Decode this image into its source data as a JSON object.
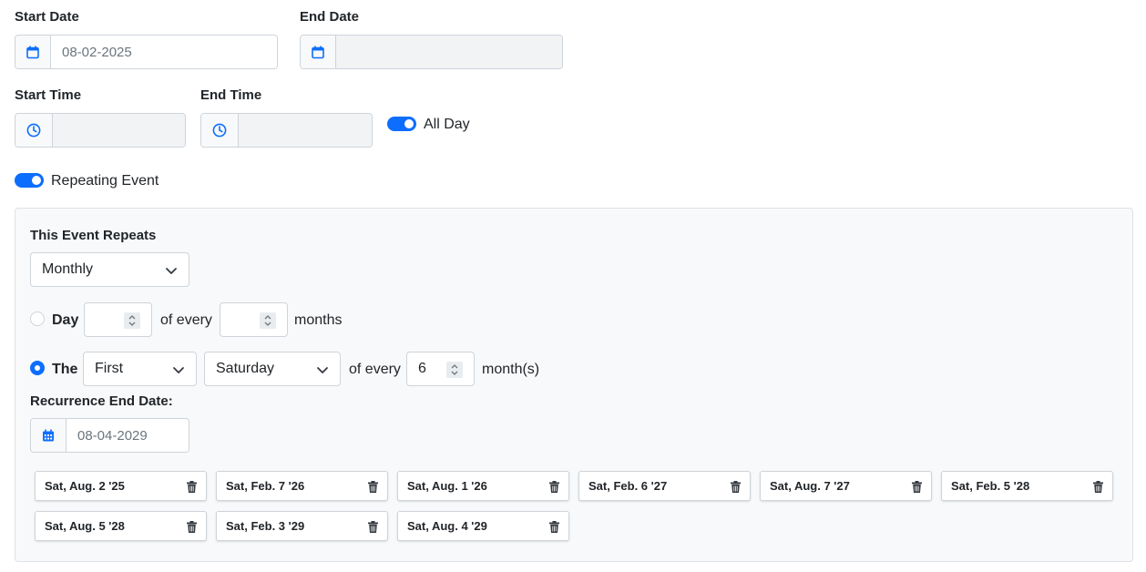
{
  "start_date": {
    "label": "Start Date",
    "value": "08-02-2025",
    "icon": "calendar-icon"
  },
  "end_date": {
    "label": "End Date",
    "value": "",
    "icon": "calendar-icon"
  },
  "start_time": {
    "label": "Start Time",
    "value": "",
    "icon": "clock-icon"
  },
  "end_time": {
    "label": "End Time",
    "value": "",
    "icon": "clock-icon"
  },
  "all_day": {
    "label": "All Day",
    "checked": true
  },
  "repeating": {
    "label": "Repeating Event",
    "checked": true
  },
  "recurrence": {
    "repeats_label": "This Event Repeats",
    "frequency": "Monthly",
    "day_option": {
      "label": "Day",
      "day_value": "",
      "of_every": "of every",
      "months_value": "",
      "months": "months",
      "selected": false
    },
    "the_option": {
      "label": "The",
      "ordinal": "First",
      "weekday": "Saturday",
      "of_every": "of every",
      "interval": "6",
      "unit": "month(s)",
      "selected": true
    },
    "end_label": "Recurrence End Date:",
    "end_value": "08-04-2029"
  },
  "occurrences": [
    "Sat, Aug. 2 '25",
    "Sat, Feb. 7 '26",
    "Sat, Aug. 1 '26",
    "Sat, Feb. 6 '27",
    "Sat, Aug. 7 '27",
    "Sat, Feb. 5 '28",
    "Sat, Aug. 5 '28",
    "Sat, Feb. 3 '29",
    "Sat, Aug. 4 '29"
  ],
  "colors": {
    "accent": "#0d6efd",
    "panel_bg": "#f8f9fa",
    "border": "#ced4da"
  }
}
